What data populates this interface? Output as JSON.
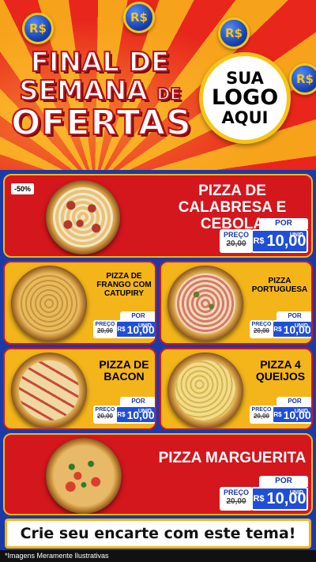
{
  "header": {
    "coin_label": "R$",
    "headline": {
      "line1": "FINAL DE",
      "line2": "SEMANA",
      "line2_small": "DE",
      "line3": "OFERTAS"
    },
    "logo": {
      "line1": "SUA",
      "line2": "LOGO",
      "line3": "AQUI"
    }
  },
  "products": [
    {
      "name": "PIZZA DE CALABRESA E CEBOLA",
      "badge": "-50%",
      "price_label": "PREÇO",
      "old_price": "20,00",
      "por": "POR",
      "currency": "R$",
      "new_price": "10,00",
      "unit": "UNID"
    },
    {
      "name": "PIZZA DE FRANGO COM CATUPIRY",
      "price_label": "PREÇO",
      "old_price": "20,00",
      "por": "POR",
      "currency": "R$",
      "new_price": "10,00",
      "unit": "UNID"
    },
    {
      "name": "PIZZA PORTUGUESA",
      "price_label": "PREÇO",
      "old_price": "20,00",
      "por": "POR",
      "currency": "R$",
      "new_price": "10,00",
      "unit": "UNID"
    },
    {
      "name": "PIZZA DE BACON",
      "price_label": "PREÇO",
      "old_price": "20,00",
      "por": "POR",
      "currency": "R$",
      "new_price": "10,00",
      "unit": "UNID"
    },
    {
      "name": "PIZZA 4 QUEIJOS",
      "price_label": "PREÇO",
      "old_price": "20,00",
      "por": "POR",
      "currency": "R$",
      "new_price": "10,00",
      "unit": "UNID"
    },
    {
      "name": "PIZZA MARGUERITA",
      "price_label": "PREÇO",
      "old_price": "20,00",
      "por": "POR",
      "currency": "R$",
      "new_price": "10,00",
      "unit": "UNID"
    }
  ],
  "cta": "Crie seu encarte com este tema!",
  "footer": "*Imagens Meramente Ilustrativas",
  "colors": {
    "red": "#d4161d",
    "yellow": "#f3b51a",
    "blue": "#1a3aa8"
  }
}
